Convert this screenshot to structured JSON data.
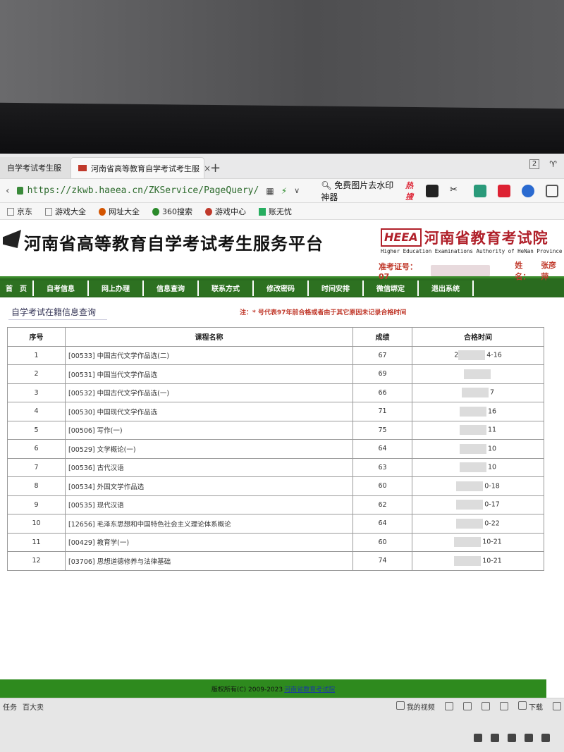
{
  "browser": {
    "tabs": [
      {
        "label": "自学考试考生服"
      },
      {
        "label": "河南省高等教育自学考试考生服"
      }
    ],
    "tab_close": "×",
    "new_tab": "+",
    "url": "https://zkwb.haeea.cn/ZKService/PageQuery/",
    "search_text": "免费图片去水印神器",
    "hot_label": "热搜",
    "bookmarks": [
      "京东",
      "游戏大全",
      "网址大全",
      "360搜索",
      "游戏中心",
      "账无忧"
    ]
  },
  "site": {
    "title": "河南省高等教育自学考试考生服务平台",
    "org_name": "河南省教育考试院",
    "org_abbr": "HEEA",
    "org_en": "Higher Education Examinations Authority of HeNan Province",
    "exam_no_label": "准考证号：07",
    "name_label": "姓名：",
    "name_value": "张彦萍",
    "nav": [
      "首　页",
      "自考信息",
      "网上办理",
      "信息查询",
      "联系方式",
      "修改密码",
      "时间安排",
      "微信绑定",
      "退出系统"
    ]
  },
  "main": {
    "section_title": "自学考试在籍信息查询",
    "note": "注：* 号代表97年前合格或者由于其它原因未记录合格时间",
    "columns": [
      "序号",
      "课程名称",
      "成绩",
      "合格时间"
    ],
    "rows": [
      {
        "no": "1",
        "course": "[00533] 中国古代文学作品选(二)",
        "score": "67",
        "time_prefix": "2",
        "time_suffix": "4-16"
      },
      {
        "no": "2",
        "course": "[00531] 中国当代文学作品选",
        "score": "69",
        "time_prefix": "",
        "time_suffix": ""
      },
      {
        "no": "3",
        "course": "[00532] 中国古代文学作品选(一)",
        "score": "66",
        "time_prefix": "",
        "time_suffix": "7"
      },
      {
        "no": "4",
        "course": "[00530] 中国现代文学作品选",
        "score": "71",
        "time_prefix": "",
        "time_suffix": "16"
      },
      {
        "no": "5",
        "course": "[00506] 写作(一)",
        "score": "75",
        "time_prefix": "",
        "time_suffix": "11"
      },
      {
        "no": "6",
        "course": "[00529] 文学概论(一)",
        "score": "64",
        "time_prefix": "",
        "time_suffix": "10"
      },
      {
        "no": "7",
        "course": "[00536] 古代汉语",
        "score": "63",
        "time_prefix": "",
        "time_suffix": "10"
      },
      {
        "no": "8",
        "course": "[00534] 外国文学作品选",
        "score": "60",
        "time_prefix": "",
        "time_suffix": "0-18"
      },
      {
        "no": "9",
        "course": "[00535] 现代汉语",
        "score": "62",
        "time_prefix": "",
        "time_suffix": "0-17"
      },
      {
        "no": "10",
        "course": "[12656] 毛泽东思想和中国特色社会主义理论体系概论",
        "score": "64",
        "time_prefix": "",
        "time_suffix": "0-22"
      },
      {
        "no": "11",
        "course": "[00429] 教育学(一)",
        "score": "60",
        "time_prefix": "",
        "time_suffix": "10-21"
      },
      {
        "no": "12",
        "course": "[03706] 思想道德修养与法律基础",
        "score": "74",
        "time_prefix": "",
        "time_suffix": "10-21"
      }
    ]
  },
  "footer": {
    "copyright": "版权所有(C) 2009-2023",
    "org_link": "河南省教育考试院"
  },
  "taskbar": {
    "left_items": [
      "任务",
      "百大卖"
    ],
    "video_label": "我的视频",
    "download_label": "下载"
  },
  "colors": {
    "nav_green": "#2a6b1f",
    "footer_green": "#2e8a1e",
    "brand_red": "#b0202a"
  }
}
